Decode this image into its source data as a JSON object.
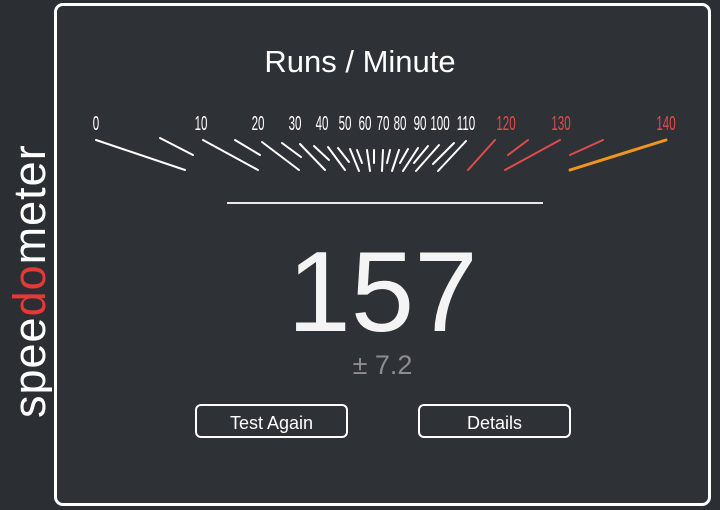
{
  "app": {
    "logo_text": {
      "pre": "spee",
      "accent": "do",
      "post": "meter"
    },
    "logo_colors": {
      "main": "#ffffff",
      "accent": "#e53935"
    }
  },
  "gauge": {
    "title": "Runs / Minute",
    "labels": [
      "0",
      "10",
      "20",
      "30",
      "40",
      "50",
      "60",
      "70",
      "80",
      "90",
      "100",
      "110",
      "120",
      "130",
      "140"
    ],
    "red_from": "120",
    "colors": {
      "normal": "#ffffff",
      "red": "#e04c4c",
      "needle": "#f0961e"
    }
  },
  "result": {
    "value": "157",
    "error": "± 7.2"
  },
  "buttons": {
    "test_again": "Test Again",
    "details": "Details"
  }
}
